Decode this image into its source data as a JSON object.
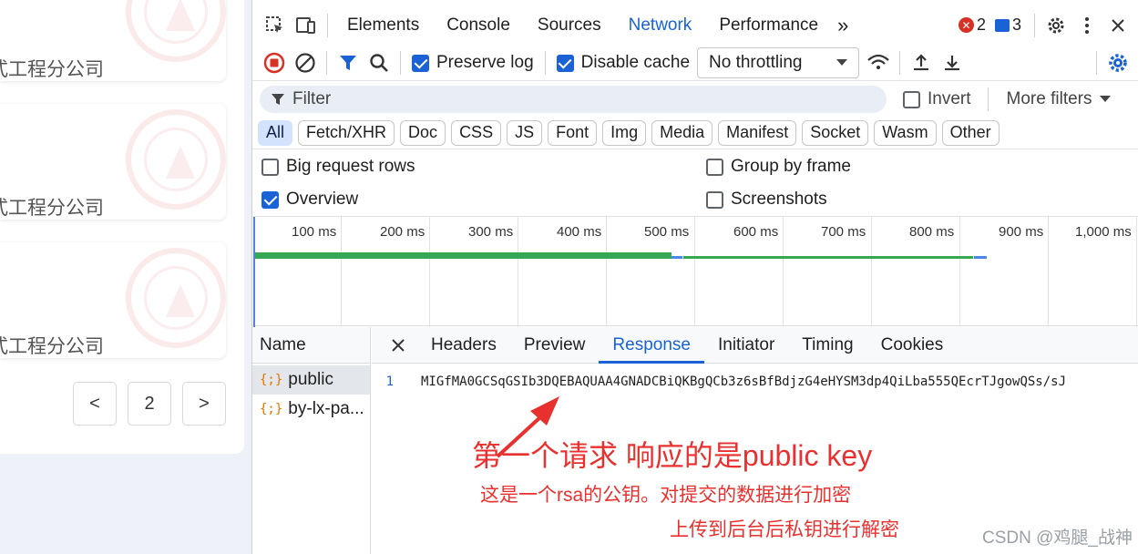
{
  "left_page": {
    "cards": [
      {
        "text": "式工程分公司"
      },
      {
        "text": "式工程分公司"
      },
      {
        "text": "式工程分公司"
      }
    ],
    "pagination": {
      "prev": "<",
      "page": "2",
      "next": ">"
    }
  },
  "devtools": {
    "main_tabs": [
      "Elements",
      "Console",
      "Sources",
      "Network",
      "Performance"
    ],
    "active_tab": "Network",
    "more_tabs": "»",
    "errors_count": "2",
    "messages_count": "3",
    "toolbar": {
      "preserve_log": "Preserve log",
      "disable_cache": "Disable cache",
      "throttling": "No throttling"
    },
    "filter": {
      "placeholder": "Filter",
      "invert": "Invert",
      "more_filters": "More filters"
    },
    "types": [
      "All",
      "Fetch/XHR",
      "Doc",
      "CSS",
      "JS",
      "Font",
      "Img",
      "Media",
      "Manifest",
      "Socket",
      "Wasm",
      "Other"
    ],
    "options": {
      "big_rows": "Big request rows",
      "group_by_frame": "Group by frame",
      "overview": "Overview",
      "screenshots": "Screenshots"
    },
    "timeline_ticks": [
      "100 ms",
      "200 ms",
      "300 ms",
      "400 ms",
      "500 ms",
      "600 ms",
      "700 ms",
      "800 ms",
      "900 ms",
      "1,000 ms"
    ],
    "requests": {
      "header": "Name",
      "items": [
        "public",
        "by-lx-pa..."
      ]
    },
    "detail_tabs": [
      "Headers",
      "Preview",
      "Response",
      "Initiator",
      "Timing",
      "Cookies"
    ],
    "active_detail_tab": "Response",
    "response": {
      "line_number": "1",
      "text": "MIGfMA0GCSqGSIb3DQEBAQUAA4GNADCBiQKBgQCb3z6sBfBdjzG4eHYSM3dp4QiLba555QEcrTJgowQSs/sJ"
    }
  },
  "annotations": {
    "title": "第一个请求 响应的是public key",
    "line1": "这是一个rsa的公钥。对提交的数据进行加密",
    "line2": "上传到后台后私钥进行解密",
    "color": "#e8312f"
  },
  "watermark": "CSDN @鸡腿_战神",
  "colors": {
    "accent": "#1a62d6",
    "error": "#d93025",
    "bar_green": "#34a853"
  }
}
